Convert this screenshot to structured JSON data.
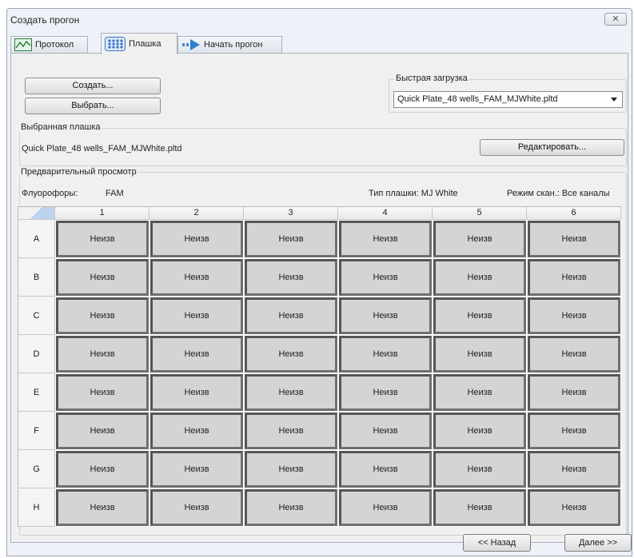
{
  "window": {
    "title": "Создать прогон",
    "close_glyph": "✕"
  },
  "tabs": [
    {
      "label": "Протокол",
      "icon": "protocol-chart-icon"
    },
    {
      "label": "Плашка",
      "icon": "plate-grid-icon",
      "active": true
    },
    {
      "label": "Начать прогон",
      "icon": "start-run-arrow-icon"
    }
  ],
  "top_buttons": {
    "create": "Создать...",
    "select": "Выбрать..."
  },
  "quick_load": {
    "label": "Быстрая загрузка",
    "selected": "Quick Plate_48 wells_FAM_MJWhite.pltd"
  },
  "selected_plate": {
    "label": "Выбранная плашка",
    "file": "Quick Plate_48 wells_FAM_MJWhite.pltd",
    "edit_button": "Редактировать..."
  },
  "preview": {
    "label": "Предварительный просмотр",
    "fluorophores_label": "Флуорофоры:",
    "fluorophores_value": "FAM",
    "plate_type": "Тип плашки: MJ White",
    "scan_mode": "Режим скан.: Все каналы"
  },
  "plate": {
    "columns": [
      "1",
      "2",
      "3",
      "4",
      "5",
      "6"
    ],
    "rows": [
      "A",
      "B",
      "C",
      "D",
      "E",
      "F",
      "G",
      "H"
    ],
    "well_label": "Неизв"
  },
  "footer": {
    "back": "<< Назад",
    "next": "Далее >>"
  }
}
